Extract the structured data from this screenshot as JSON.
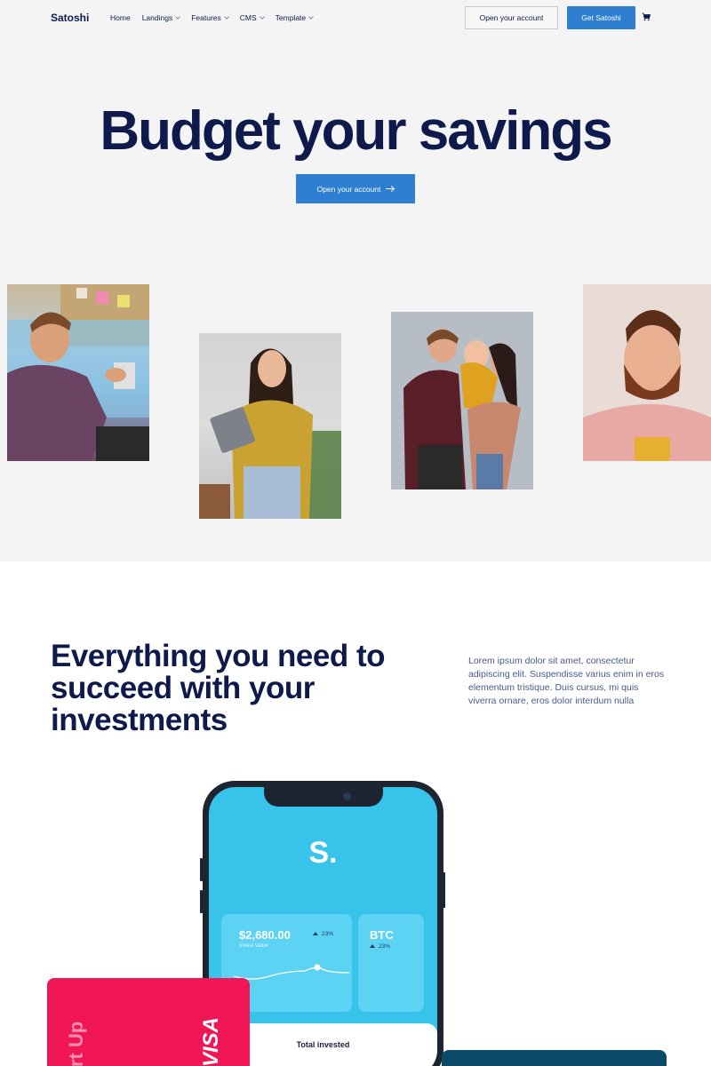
{
  "nav": {
    "brand": "Satoshi",
    "links": [
      {
        "label": "Home",
        "dropdown": false
      },
      {
        "label": "Landings",
        "dropdown": true
      },
      {
        "label": "Features",
        "dropdown": true
      },
      {
        "label": "CMS",
        "dropdown": true
      },
      {
        "label": "Template",
        "dropdown": true
      }
    ],
    "open_account_label": "Open your account",
    "get_label": "Get Satoshi",
    "cart_icon": "cart-icon"
  },
  "hero": {
    "title": "Budget your savings",
    "cta_label": "Open your account",
    "cta_icon": "arrow-right-icon"
  },
  "section2": {
    "title": "Everything you need to succeed with your investments",
    "text": "Lorem ipsum dolor sit amet, consectetur adipiscing elit. Suspendisse varius enim in eros elementum tristique. Duis cursus, mi quis viverra ornare, eros dolor interdum nulla"
  },
  "phone": {
    "logo": "S.",
    "invest_value": "$2,680.00",
    "invest_label": "Invest Value",
    "invest_pct": "23%",
    "btc_name": "BTC",
    "btc_pct": "23%",
    "total_label": "Total invested"
  },
  "card": {
    "startup_text": "rt Up",
    "brand": "VISA"
  },
  "colors": {
    "navy": "#0e1a4b",
    "primary": "#2e7ed1",
    "phone_screen": "#37c3ea",
    "card_red": "#f01656",
    "card_teal": "#0b4a68"
  }
}
